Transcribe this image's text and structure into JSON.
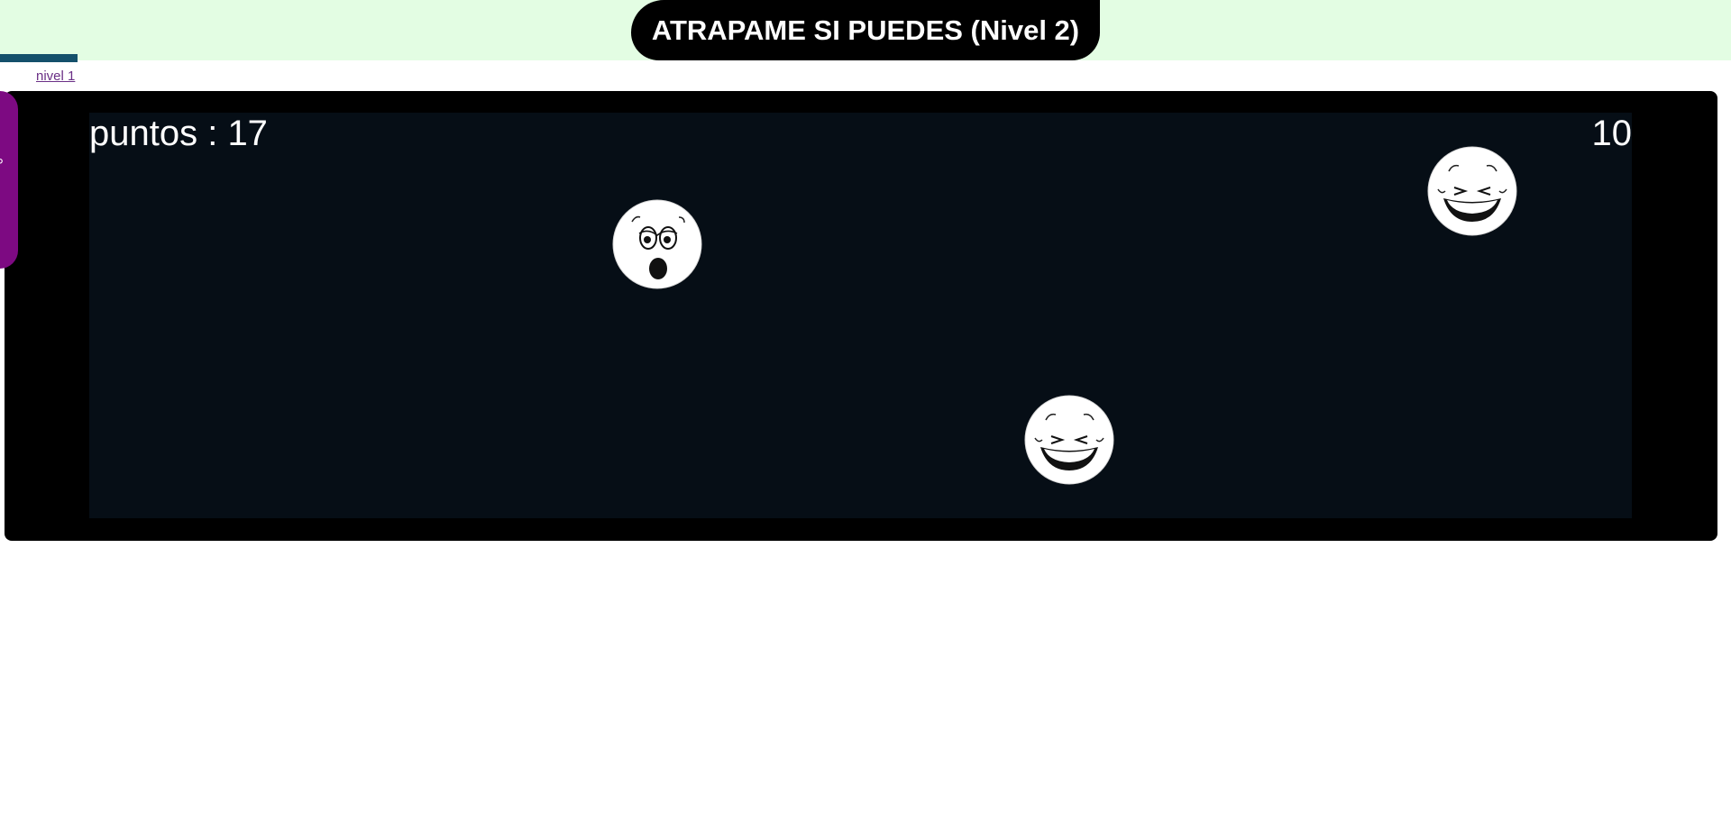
{
  "header": {
    "title": "ATRAPAME SI PUEDES (Nivel 2)"
  },
  "nav": {
    "level_link": "nivel 1"
  },
  "side_tab": {
    "glyph": "°"
  },
  "game": {
    "score_text": "puntos : 17",
    "timer_text": "10",
    "faces": [
      {
        "expression": "surprised-face-icon"
      },
      {
        "expression": "laughing-face-icon"
      },
      {
        "expression": "laughing-face-icon"
      }
    ]
  },
  "colors": {
    "header_band": "#e3fde3",
    "title_bg": "#000000",
    "progress_strip": "#14506b",
    "side_tab": "#7d0a82",
    "arena_bg": "#060e16",
    "link": "#6a2f86"
  }
}
